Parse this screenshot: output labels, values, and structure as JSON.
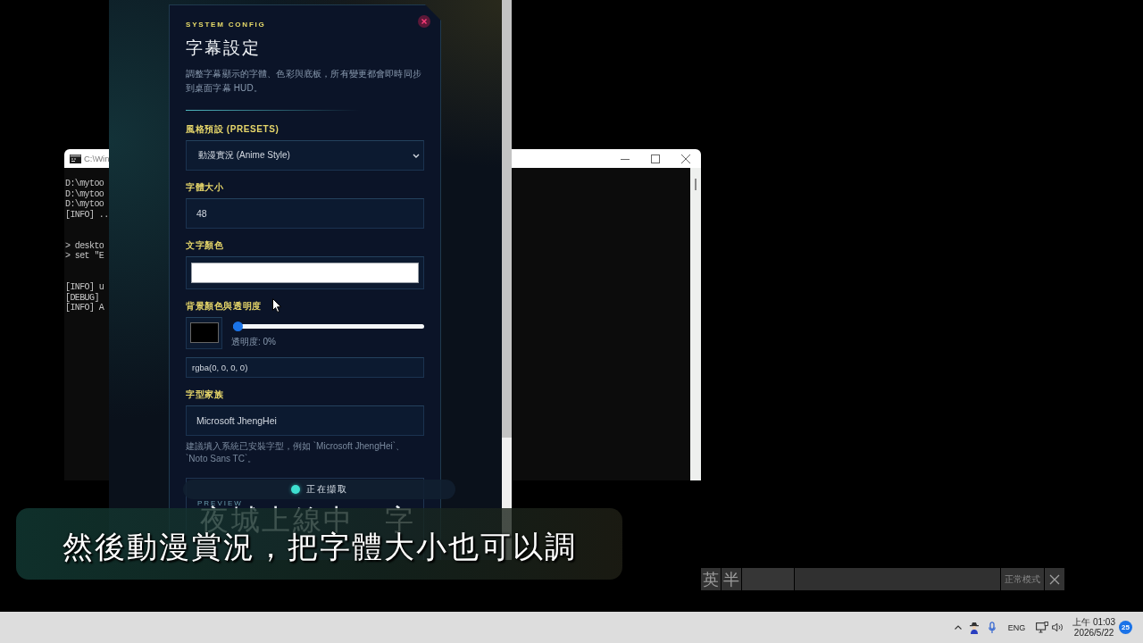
{
  "console_window": {
    "title": "C:\\Win",
    "line_groups": [
      {
        "lines": [
          "D:\\mytoo",
          "D:\\mytoo",
          "D:\\mytoo",
          "[INFO] .."
        ]
      },
      {
        "lines": [
          "> deskto",
          "> set \"E"
        ]
      },
      {
        "lines": [
          "[INFO] u",
          "[DEBUG]",
          "[INFO] A"
        ]
      }
    ]
  },
  "config_panel": {
    "eyebrow": "SYSTEM CONFIG",
    "title": "字幕設定",
    "description": "調整字幕顯示的字體、色彩與底板，所有變更都會即時同步到桌面字幕 HUD。",
    "fields": [
      {
        "kind": "select",
        "label": "風格預設 (PRESETS)",
        "value": "動漫實況 (Anime Style)"
      },
      {
        "kind": "text",
        "label": "字體大小",
        "value": "48"
      },
      {
        "kind": "color",
        "label": "文字顏色",
        "color": "#ffffff"
      },
      {
        "kind": "background",
        "label": "背景顏色與透明度",
        "color": "#000000",
        "level": 0,
        "reading": "透明度: 0%",
        "value": "rgba(0, 0, 0, 0)"
      },
      {
        "kind": "text",
        "label": "字型家族",
        "value": "Microsoft JhengHei",
        "hint": "建議填入系統已安裝字型，例如 `Microsoft JhengHei`、`Noto Sans TC`。"
      }
    ],
    "preview": {
      "label": "PREVIEW",
      "text": "夜城上線中　字"
    }
  },
  "status_pill": {
    "text": "正在擷取"
  },
  "subtitle_hud": {
    "text": "然後動漫賞況，把字體大小也可以調"
  },
  "ime_bar": {
    "cells": [
      {
        "kind": "key",
        "text": "英"
      },
      {
        "kind": "key",
        "text": "半"
      },
      {
        "kind": "blank"
      },
      {
        "kind": "blank"
      },
      {
        "kind": "mode",
        "text": "正常模式"
      },
      {
        "kind": "close"
      }
    ]
  },
  "taskbar": {
    "language": "ENG",
    "time": "上午 01:03",
    "date": "2026/5/22",
    "notification_count": "25"
  }
}
